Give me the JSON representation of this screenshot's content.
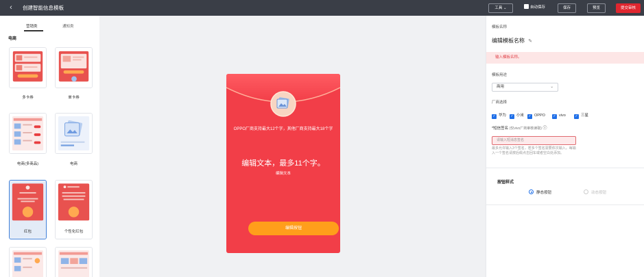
{
  "topbar": {
    "back_glyph": "‹",
    "title": "创建智能信息模板",
    "tools_label": "工具 ⌄",
    "autosave_label": "自动保存",
    "save_label": "保存",
    "preview_label": "预览",
    "submit_label": "提交审核"
  },
  "left": {
    "tabs": [
      "营销类",
      "通知类"
    ],
    "category": "电商",
    "cards": [
      "多卡券",
      "单卡券",
      "电商(多商品)",
      "电商",
      "红包",
      "个性化红包"
    ]
  },
  "preview": {
    "header_text": "OPPO厂商支持最大12个字，其他厂商支持最大18个字",
    "big_text": "编辑文本，最多11个字。",
    "small_text": "编辑文本",
    "button_text": "编辑按钮"
  },
  "right": {
    "name_label": "模板名称",
    "name_value": "编辑模板名称",
    "name_warning": "输入模板名称。",
    "usage_label": "模板用途",
    "usage_value": "商用",
    "vendor_label": "厂商选择",
    "vendors": [
      "华为",
      "小米",
      "OPPO",
      "vivo",
      "三星"
    ],
    "signature_label": "*短信签名",
    "signature_hint": "(仅vivo厂商审核读取)",
    "signature_placeholder": "请输入短消息签名",
    "signature_help": "最多允许输入3个签名，若多个签名需要依次输入。每输入一个签名请按后缀点击回车或者空白处添加。",
    "button_style_title": "按钮样式",
    "radio_static": "静态按钮",
    "radio_dynamic": "动态按钮"
  },
  "colors": {
    "topbar": "#3a3e47",
    "accent_red": "#e0262f",
    "envelope_red": "#f23e48",
    "button_orange": "#ff9e1b",
    "check_blue": "#1f6fe8"
  }
}
